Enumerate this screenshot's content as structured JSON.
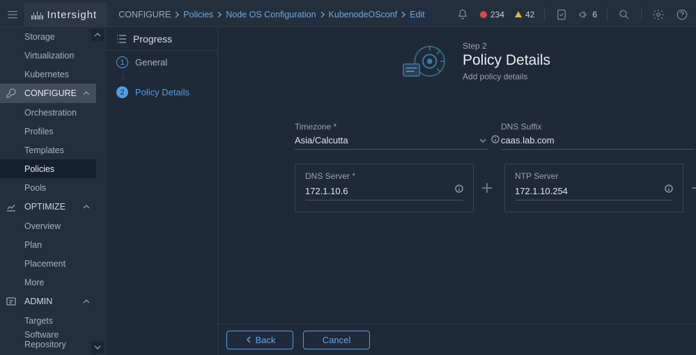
{
  "brand": "Intersight",
  "breadcrumb": {
    "root": "CONFIGURE",
    "items": [
      "Policies",
      "Node OS Configuration",
      "KubenodeOSconf",
      "Edit"
    ]
  },
  "header": {
    "alerts_critical": "234",
    "alerts_warning": "42",
    "messages": "6"
  },
  "sidebar": {
    "plain_top": [
      "Storage",
      "Virtualization",
      "Kubernetes"
    ],
    "configure_label": "CONFIGURE",
    "configure_items": [
      "Orchestration",
      "Profiles",
      "Templates",
      "Policies",
      "Pools"
    ],
    "optimize_label": "OPTIMIZE",
    "optimize_items": [
      "Overview",
      "Plan",
      "Placement",
      "More"
    ],
    "admin_label": "ADMIN",
    "admin_items": [
      "Targets",
      "Software Repository"
    ]
  },
  "progress": {
    "title": "Progress",
    "steps": [
      {
        "num": "1",
        "label": "General"
      },
      {
        "num": "2",
        "label": "Policy Details"
      }
    ]
  },
  "page": {
    "step_label": "Step 2",
    "title": "Policy Details",
    "subtitle": "Add policy details"
  },
  "form": {
    "timezone_label": "Timezone *",
    "timezone_value": "Asia/Calcutta",
    "dns_suffix_label": "DNS Suffix",
    "dns_suffix_value": "caas.lab.com",
    "dns_server_label": "DNS Server *",
    "dns_server_value": "172.1.10.6",
    "ntp_server_label": "NTP Server",
    "ntp_server_value": "172.1.10.254"
  },
  "footer": {
    "back": "Back",
    "cancel": "Cancel"
  }
}
